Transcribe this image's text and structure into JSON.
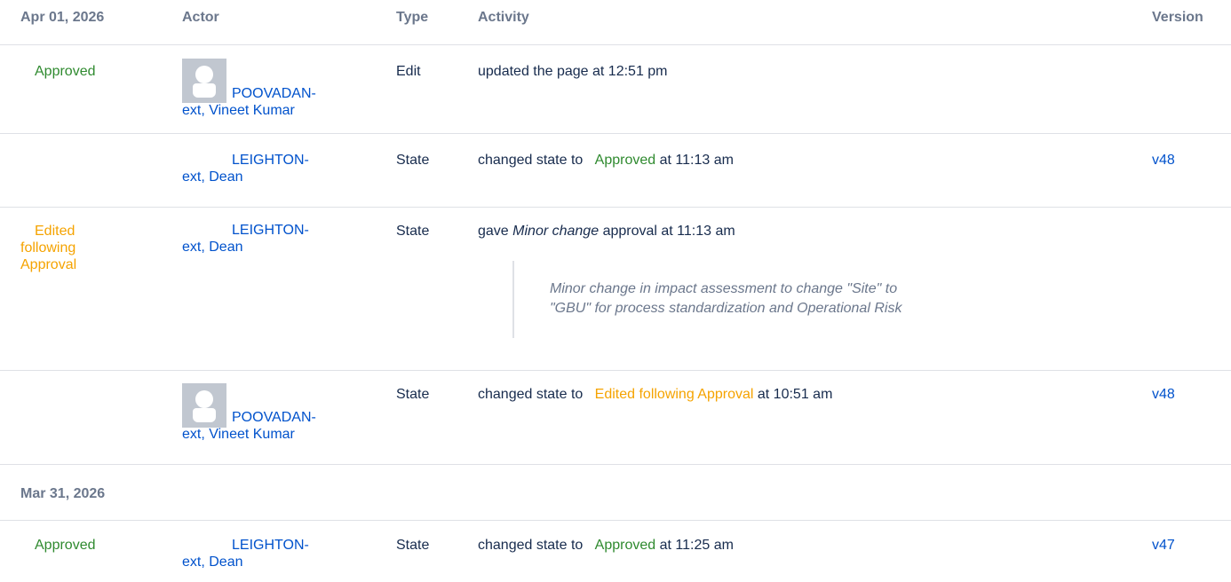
{
  "header": {
    "date": "Apr 01, 2026",
    "actor": "Actor",
    "type": "Type",
    "activity": "Activity",
    "version": "Version"
  },
  "rows": [
    {
      "state": "Approved",
      "actor_line1": "POOVADAN-",
      "actor_line2": "ext, Vineet Kumar",
      "type": "Edit",
      "activity": "updated the page at 12:51 pm",
      "version": ""
    },
    {
      "state": "",
      "actor_line1": "LEIGHTON-",
      "actor_line2": "ext, Dean",
      "type": "State",
      "activity_prefix": "changed state to",
      "activity_state": "Approved",
      "activity_suffix": "at 11:13 am",
      "version": "v48"
    },
    {
      "state_line1": "Edited",
      "state_line2": "following",
      "state_line3": "Approval",
      "actor_line1": "LEIGHTON-",
      "actor_line2": "ext, Dean",
      "type": "State",
      "activity_prefix": "gave",
      "activity_em": "Minor change",
      "activity_suffix": "approval at 11:13 am",
      "comment_line1": "Minor change in impact assessment to change \"Site\" to",
      "comment_line2": "\"GBU\" for process standardization and Operational Risk"
    },
    {
      "actor_line1": "POOVADAN-",
      "actor_line2": "ext, Vineet Kumar",
      "type": "State",
      "activity_prefix": "changed state to",
      "activity_state": "Edited following Approval",
      "activity_suffix": "at 10:51 am",
      "version": "v48"
    }
  ],
  "date2": "Mar 31, 2026",
  "rows2": [
    {
      "state": "Approved",
      "actor_line1": "LEIGHTON-",
      "actor_line2": "ext, Dean",
      "type": "State",
      "activity_prefix": "changed state to",
      "activity_state": "Approved",
      "activity_suffix": "at 11:25 am",
      "version": "v47"
    }
  ],
  "colors": {
    "approved": "#2f8a2f",
    "edited": "#f5a300",
    "link": "#0052cc",
    "muted": "#6b778c"
  },
  "icons": {
    "avatar": "default-user-avatar-icon"
  }
}
